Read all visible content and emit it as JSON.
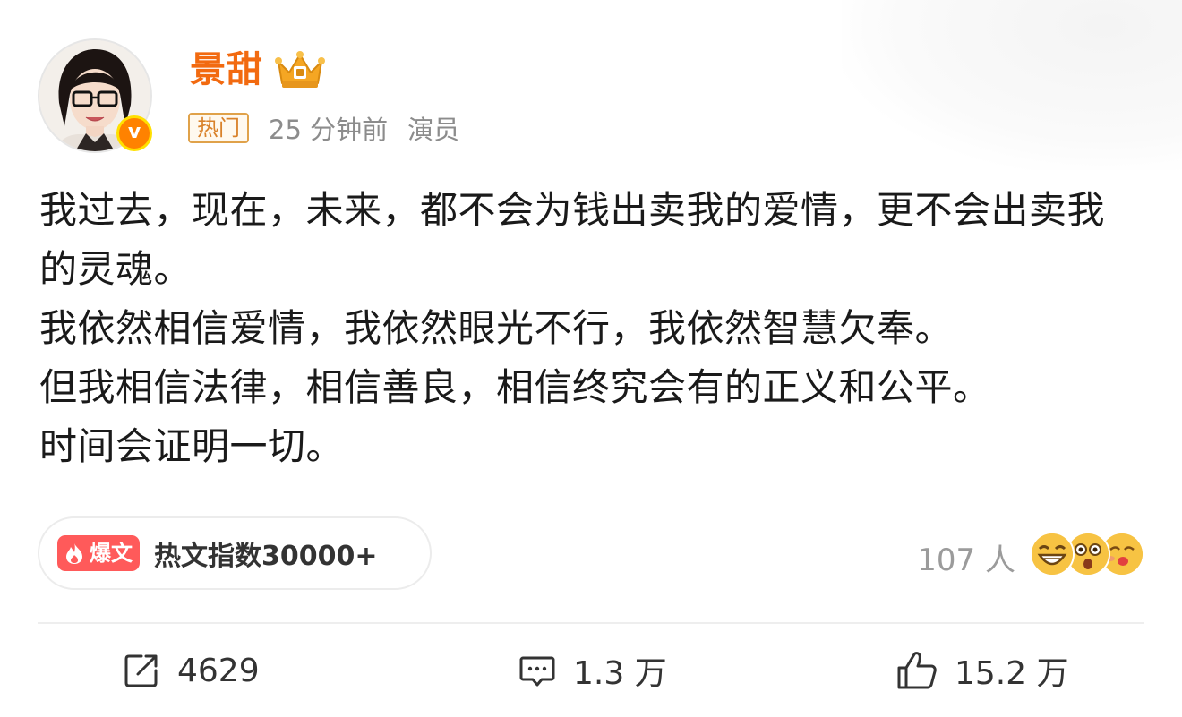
{
  "user": {
    "name": "景甜",
    "hot_tag": "热门",
    "time": "25 分钟前",
    "role": "演员"
  },
  "post": {
    "lines": [
      "我过去，现在，未来，都不会为钱出卖我的爱情，更不会出卖我的灵魂。",
      "我依然相信爱情，我依然眼光不行，我依然智慧欠奉。",
      "但我相信法律，相信善良，相信终究会有的正义和公平。",
      "时间会证明一切。"
    ]
  },
  "hot_index": {
    "tag_label": "爆文",
    "text": "热文指数30000+"
  },
  "reactions": {
    "count_text": "107 人",
    "emojis": [
      "grin-emoji",
      "shocked-emoji",
      "kiss-emoji"
    ]
  },
  "actions": {
    "repost": "4629",
    "comment": "1.3 万",
    "like": "15.2 万"
  },
  "colors": {
    "username": "#f26a10",
    "verified": "#ff8200",
    "hot_tag": "#d9822b",
    "baowen": "#ff5a5a"
  }
}
